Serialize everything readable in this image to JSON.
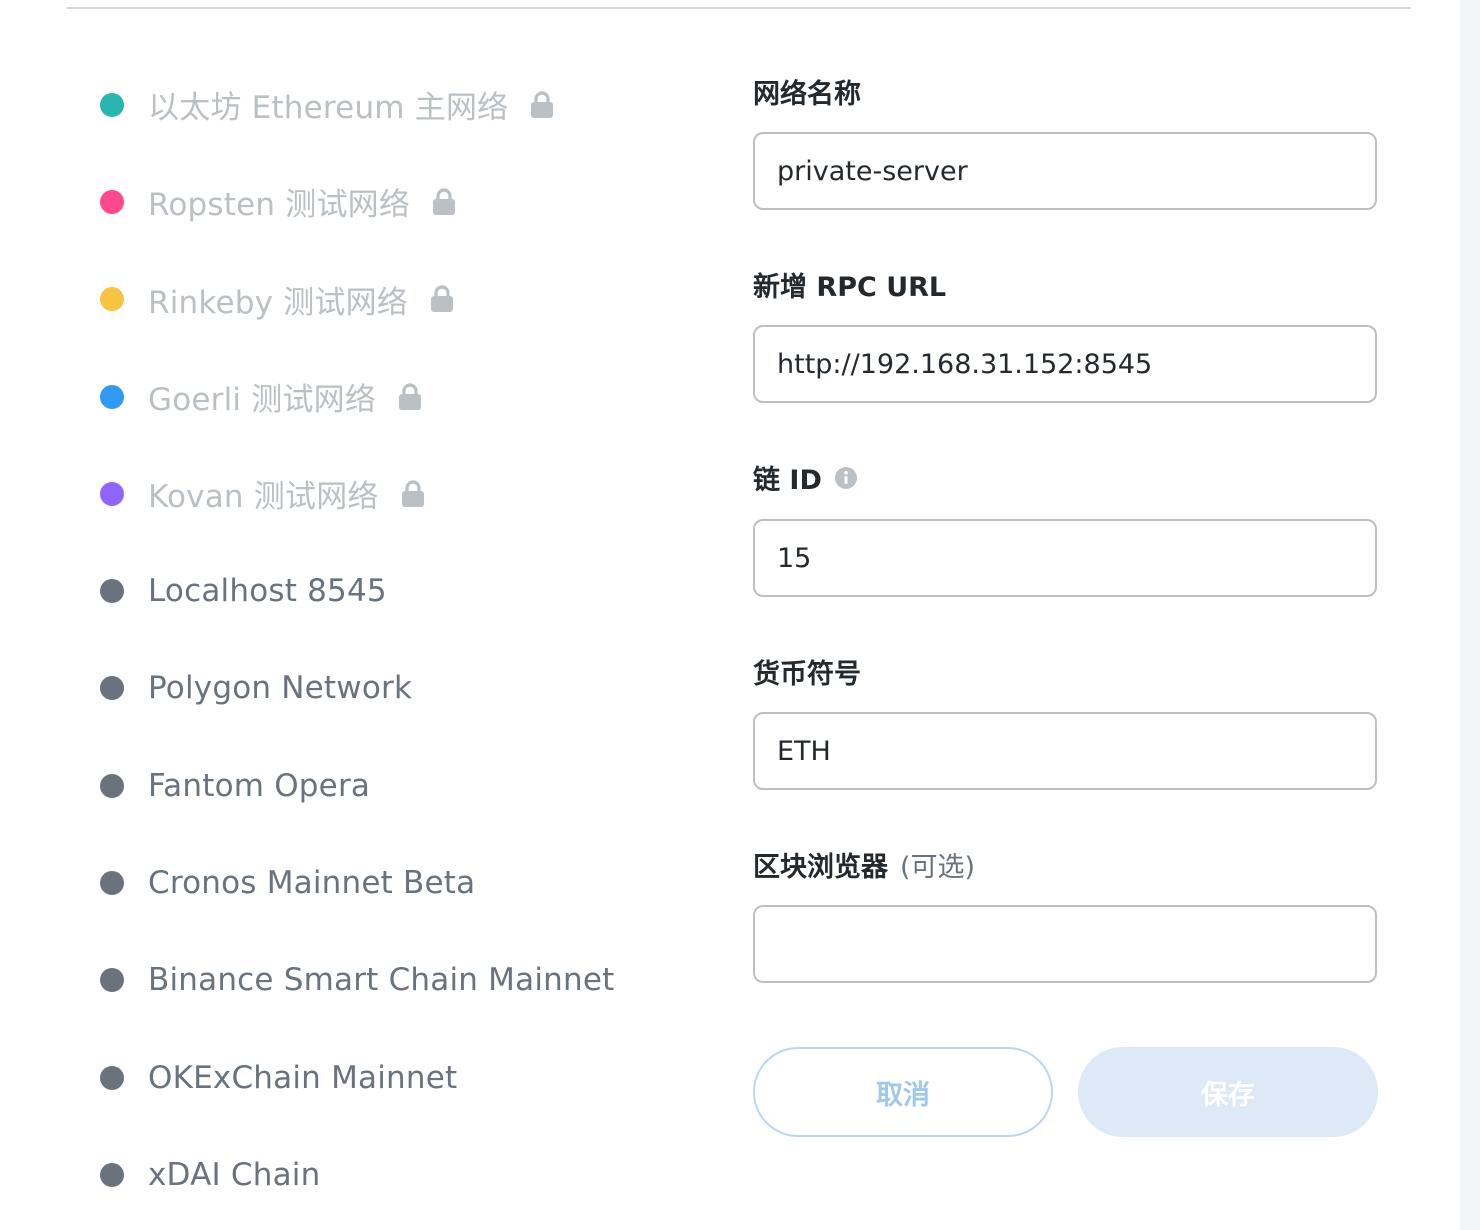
{
  "networks": [
    {
      "label": "以太坊 Ethereum 主网络",
      "dot_color": "#29b6af",
      "locked": true
    },
    {
      "label": "Ropsten 测试网络",
      "dot_color": "#ff4a8d",
      "locked": true
    },
    {
      "label": "Rinkeby 测试网络",
      "dot_color": "#f6c343",
      "locked": true
    },
    {
      "label": "Goerli 测试网络",
      "dot_color": "#3099f2",
      "locked": true
    },
    {
      "label": "Kovan 测试网络",
      "dot_color": "#9064ff",
      "locked": true
    },
    {
      "label": "Localhost 8545",
      "dot_color": "#6a737d",
      "locked": false
    },
    {
      "label": "Polygon Network",
      "dot_color": "#6a737d",
      "locked": false
    },
    {
      "label": "Fantom Opera",
      "dot_color": "#6a737d",
      "locked": false
    },
    {
      "label": "Cronos Mainnet Beta",
      "dot_color": "#6a737d",
      "locked": false
    },
    {
      "label": "Binance Smart Chain Mainnet",
      "dot_color": "#6a737d",
      "locked": false
    },
    {
      "label": "OKExChain Mainnet",
      "dot_color": "#6a737d",
      "locked": false
    },
    {
      "label": "xDAI Chain",
      "dot_color": "#6a737d",
      "locked": false
    }
  ],
  "form": {
    "network_name": {
      "label": "网络名称",
      "value": "private-server"
    },
    "rpc_url": {
      "label": "新增 RPC URL",
      "value": "http://192.168.31.152:8545"
    },
    "chain_id": {
      "label": "链 ID",
      "value": "15"
    },
    "currency_symbol": {
      "label": "货币符号",
      "value": "ETH"
    },
    "block_explorer": {
      "label": "区块浏览器",
      "optional": "(可选)",
      "value": ""
    }
  },
  "buttons": {
    "cancel": "取消",
    "save": "保存"
  },
  "icons": {
    "lock": "lock-icon",
    "info": "info-icon"
  }
}
